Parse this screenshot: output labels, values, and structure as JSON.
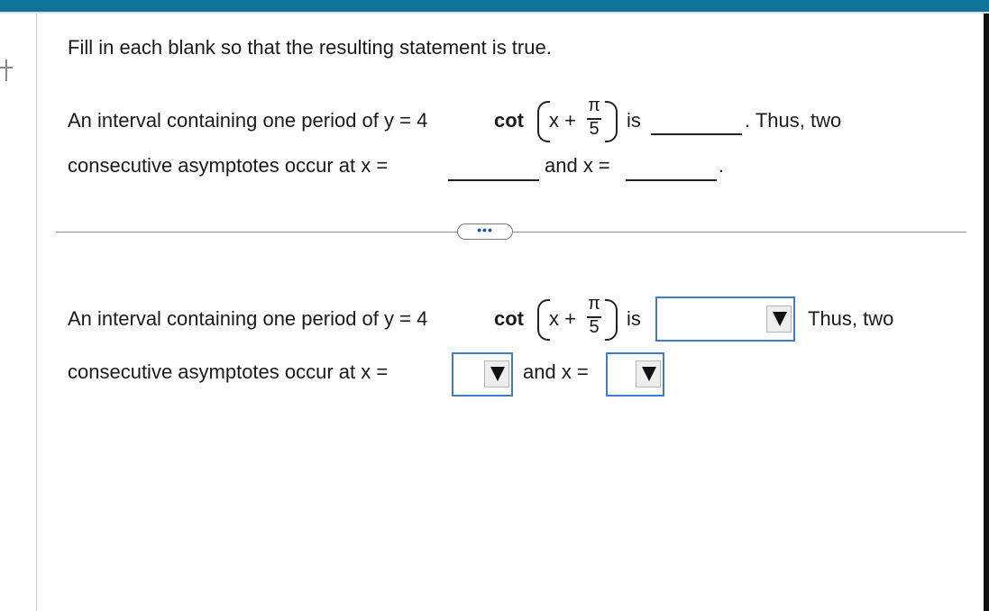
{
  "instruction": "Fill in each blank so that the resulting statement is true.",
  "statement": {
    "intro": "An interval containing one period of y = 4",
    "func": "cot",
    "x_plus": "x +",
    "pi": "π",
    "denominator": "5",
    "is": "is",
    "thus_two": "Thus, two",
    "thus_two_period": ". Thus, two",
    "line2_start": "consecutive asymptotes occur at x =",
    "and_x": "and x =",
    "period": "."
  },
  "more_button": {
    "label": "•••"
  },
  "answers": {
    "interval": {
      "value": ""
    },
    "asymptote1": {
      "value": ""
    },
    "asymptote2": {
      "value": ""
    }
  },
  "colors": {
    "topbar": "#0e7299",
    "dropdown_border": "#3f7ec6"
  }
}
